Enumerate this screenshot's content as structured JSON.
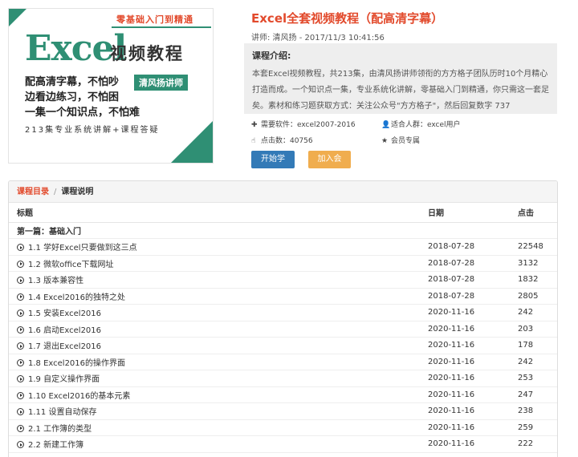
{
  "cover": {
    "tag": "零基础入门到精通",
    "big": "Excel",
    "big_cn": "视频教程",
    "line1": "配高清字幕，不怕吵",
    "line2": "边看边练习，不怕困",
    "line3": "一集一个知识点，不怕难",
    "teacher": "清风扬讲师",
    "bottom": "213集专业系统讲解+课程答疑"
  },
  "course": {
    "title": "Excel全套视频教程（配高清字幕）",
    "meta": "讲师: 清风扬 - 2017/11/3 10:41:56",
    "intro_heading": "课程介绍:",
    "intro_text": "本套Excel视频教程，共213集，由清风扬讲师领衔的方方格子团队历时10个月精心打造而成。一个知识点一集，专业系统化讲解，零基础入门到精通，你只需这一套足矣。素材和练习题获取方式：关注公众号\"方方格子\"，然后回复数字 737",
    "facts": {
      "software": "需要软件：excel2007-2016",
      "audience": "适合人群：excel用户",
      "clicks": "点击数：40756",
      "member": "会员专属"
    },
    "btn_start": "开始学习",
    "btn_join": "加入会员"
  },
  "tabs": {
    "active": "课程目录",
    "other": "课程说明"
  },
  "table": {
    "headers": [
      "标题",
      "日期",
      "点击"
    ],
    "section": "第一篇：基础入门",
    "rows": [
      {
        "title": "1.1 学好Excel只要做到这三点",
        "date": "2018-07-28",
        "clicks": "22548"
      },
      {
        "title": "1.2 微软office下载网址",
        "date": "2018-07-28",
        "clicks": "3132"
      },
      {
        "title": "1.3 版本兼容性",
        "date": "2018-07-28",
        "clicks": "1832"
      },
      {
        "title": "1.4 Excel2016的独特之处",
        "date": "2018-07-28",
        "clicks": "2805"
      },
      {
        "title": "1.5 安装Excel2016",
        "date": "2020-11-16",
        "clicks": "242"
      },
      {
        "title": "1.6 启动Excel2016",
        "date": "2020-11-16",
        "clicks": "203"
      },
      {
        "title": "1.7 退出Excel2016",
        "date": "2020-11-16",
        "clicks": "178"
      },
      {
        "title": "1.8 Excel2016的操作界面",
        "date": "2020-11-16",
        "clicks": "242"
      },
      {
        "title": "1.9 自定义操作界面",
        "date": "2020-11-16",
        "clicks": "253"
      },
      {
        "title": "1.10 Excel2016的基本元素",
        "date": "2020-11-16",
        "clicks": "247"
      },
      {
        "title": "1.11 设置自动保存",
        "date": "2020-11-16",
        "clicks": "238"
      },
      {
        "title": "2.1 工作簿的类型",
        "date": "2020-11-16",
        "clicks": "259"
      },
      {
        "title": "2.2 新建工作簿",
        "date": "2020-11-16",
        "clicks": "222"
      }
    ]
  }
}
